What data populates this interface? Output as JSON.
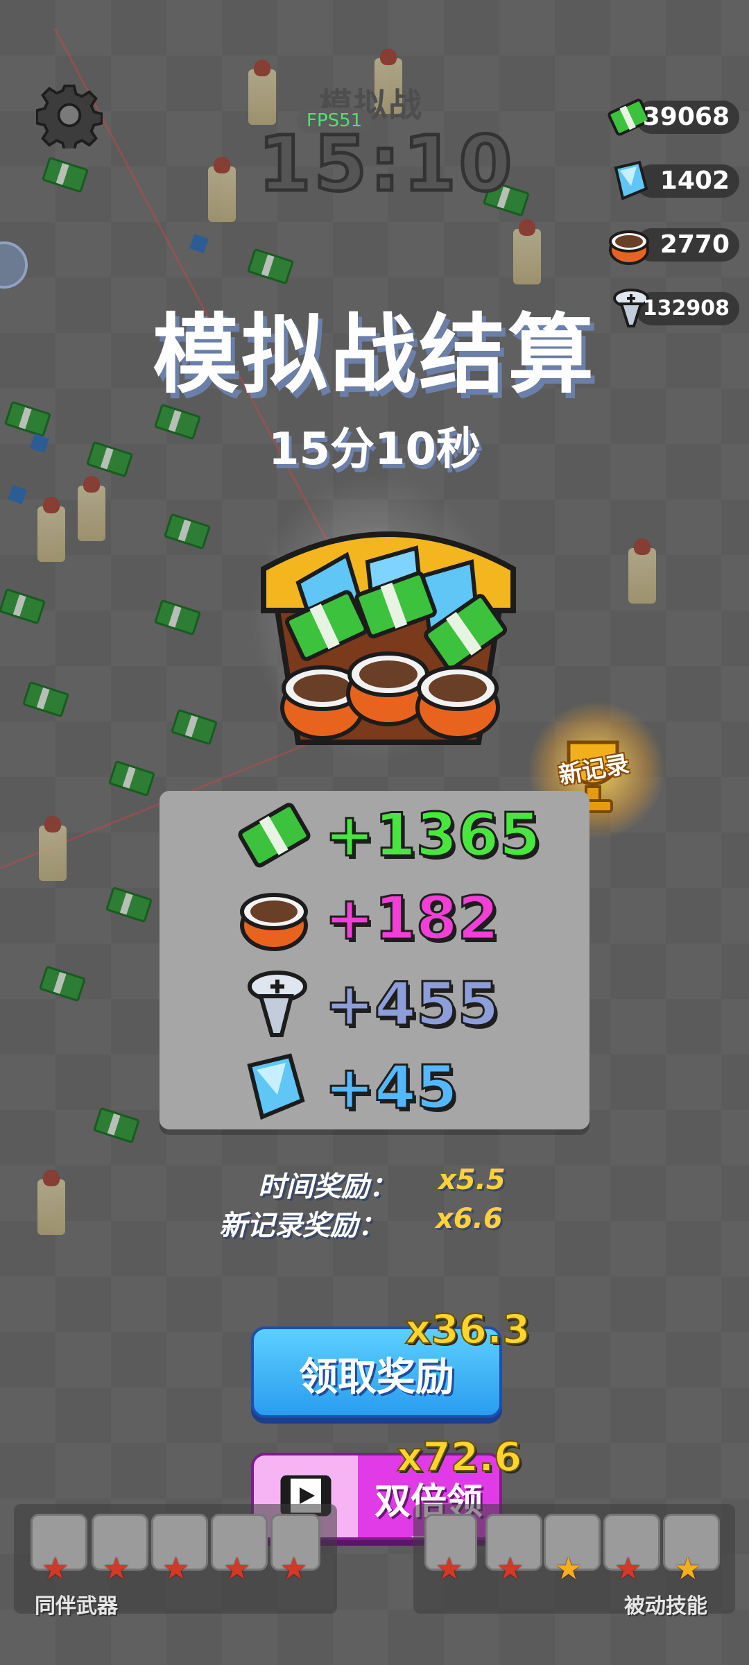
{
  "hud": {
    "mode_title": "模拟战",
    "fps": "FPS51",
    "timer": "15:10"
  },
  "resources": [
    {
      "icon": "cash-icon",
      "value": "39068"
    },
    {
      "icon": "gem-icon",
      "value": "1402"
    },
    {
      "icon": "can-icon",
      "value": "2770"
    },
    {
      "icon": "screw-icon",
      "value": "132908"
    }
  ],
  "result": {
    "title": "模拟战结算",
    "duration": "15分10秒",
    "new_record_badge": "新记录"
  },
  "rewards": [
    {
      "icon": "cash-icon",
      "amount": "+1365",
      "color": "#49e63f"
    },
    {
      "icon": "can-icon",
      "amount": "+182",
      "color": "#f23fd6"
    },
    {
      "icon": "screw-icon",
      "amount": "+455",
      "color": "#8e9ed8"
    },
    {
      "icon": "gem-icon",
      "amount": "+45",
      "color": "#55b8ff"
    }
  ],
  "bonuses": {
    "time_label": "时间奖励：",
    "time_value": "x5.5",
    "record_label": "新记录奖励：",
    "record_value": "x6.6"
  },
  "buttons": {
    "claim_label": "领取奖励",
    "claim_multiplier": "x36.3",
    "double_label": "双倍领取",
    "double_multiplier": "x72.6"
  },
  "bottom": {
    "companion_label": "同伴武器",
    "passive_label": "被动技能"
  }
}
